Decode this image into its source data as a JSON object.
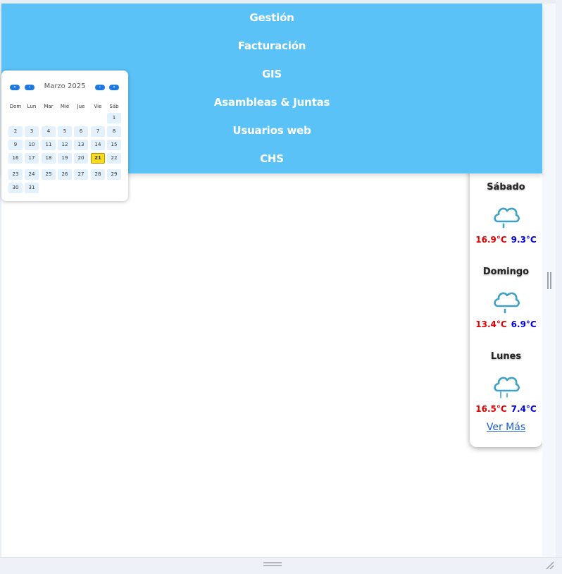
{
  "menu": {
    "items": [
      "Gestión",
      "Facturación",
      "GIS",
      "Asambleas & Juntas",
      "Usuarios web",
      "CHS"
    ]
  },
  "calendar": {
    "month_label": "Marzo 2025",
    "weekdays": [
      "Dom",
      "Lun",
      "Mar",
      "Mié",
      "Jue",
      "Vie",
      "Sáb"
    ],
    "today": "21",
    "weeks": [
      [
        "",
        "",
        "",
        "",
        "",
        "",
        "1"
      ],
      [
        "2",
        "3",
        "4",
        "5",
        "6",
        "7",
        "8"
      ],
      [
        "9",
        "10",
        "11",
        "12",
        "13",
        "14",
        "15"
      ],
      [
        "16",
        "17",
        "18",
        "19",
        "20",
        "21",
        "22"
      ],
      [
        "23",
        "24",
        "25",
        "26",
        "27",
        "28",
        "29"
      ],
      [
        "30",
        "31",
        "",
        "",
        "",
        "",
        ""
      ]
    ],
    "nav_icons": [
      "double-left-icon",
      "left-icon",
      "right-icon",
      "double-right-icon"
    ],
    "accent_color": "#1a78e0",
    "today_color": "#f7dd1c"
  },
  "weather": {
    "days": [
      {
        "name": "Sábado",
        "max": "16.9°C",
        "min": "9.3°C",
        "icon": "rain-cloud-icon"
      },
      {
        "name": "Domingo",
        "max": "13.4°C",
        "min": "6.9°C",
        "icon": "rain-cloud-icon"
      },
      {
        "name": "Lunes",
        "max": "16.5°C",
        "min": "7.4°C",
        "icon": "rain-cloud-icon"
      }
    ],
    "more_label": "Ver Más",
    "max_color": "#e40000",
    "min_color": "#0000e6"
  },
  "colors": {
    "menu_bg": "#5bc2f8",
    "calendar_day_bg": "#e3f1fc"
  }
}
